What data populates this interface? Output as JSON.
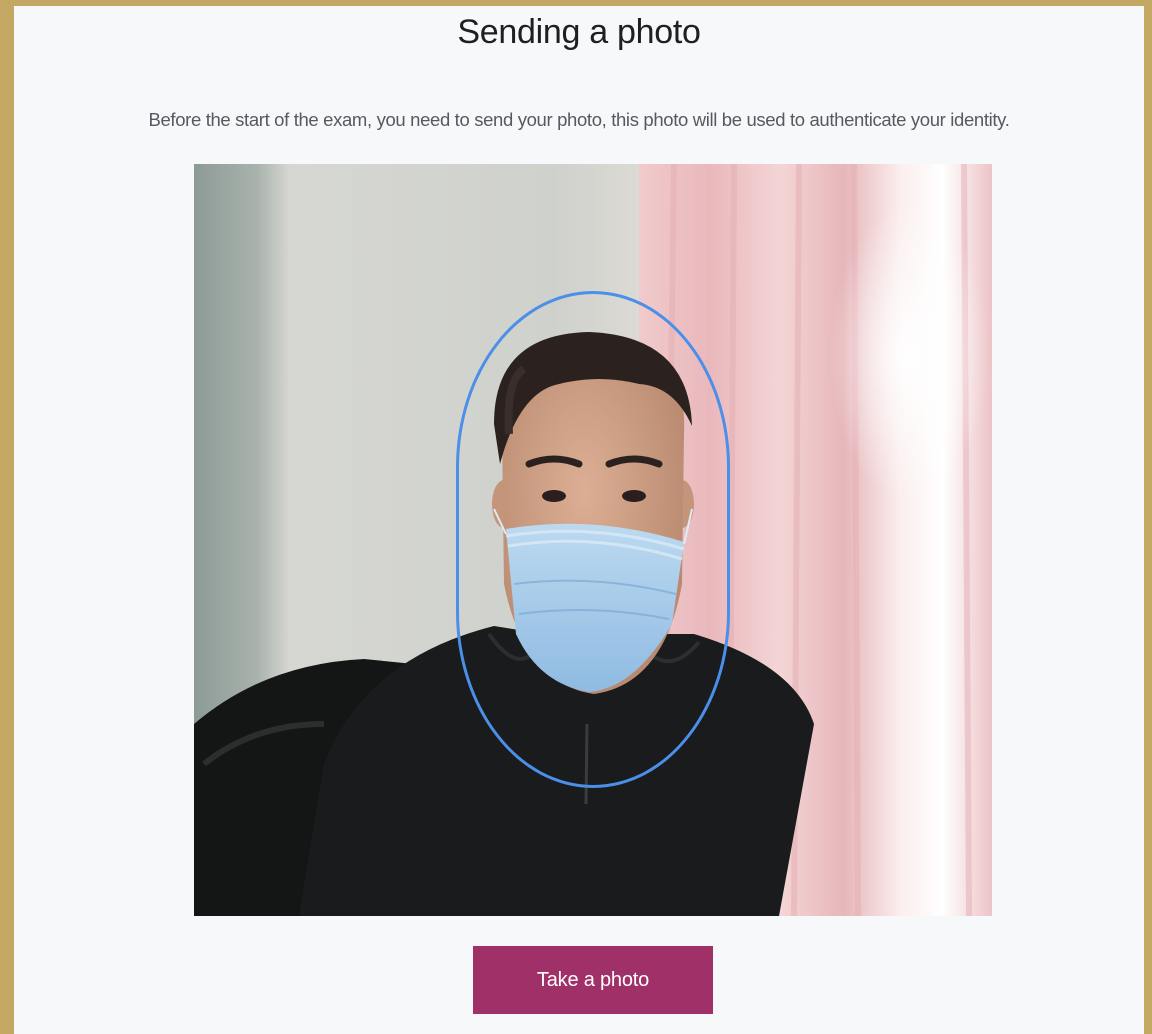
{
  "page": {
    "title": "Sending a photo",
    "subtitle": "Before the start of the exam, you need to send your photo, this photo will be used to authenticate your identity."
  },
  "camera": {
    "icon": "webcam-preview",
    "guide_color": "#4b8fe8"
  },
  "actions": {
    "take_photo_label": "Take a photo",
    "button_color": "#a03168"
  },
  "theme": {
    "frame_color": "#c3a863",
    "panel_color": "#f7f8fa"
  }
}
